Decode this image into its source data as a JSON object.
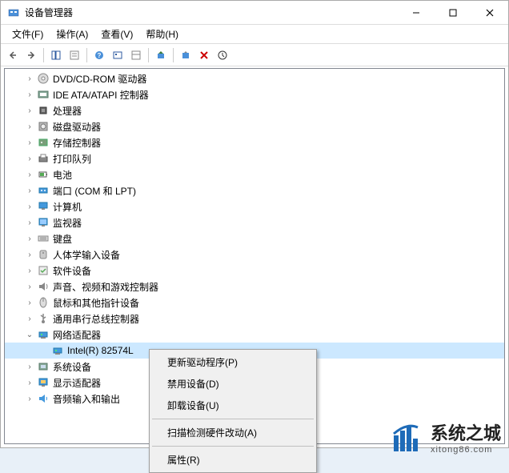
{
  "window": {
    "title": "设备管理器"
  },
  "menubar": {
    "file": "文件(F)",
    "action": "操作(A)",
    "view": "查看(V)",
    "help": "帮助(H)"
  },
  "tree": {
    "items": [
      {
        "expander": ">",
        "icon": "dvd",
        "label": "DVD/CD-ROM 驱动器"
      },
      {
        "expander": ">",
        "icon": "ide",
        "label": "IDE ATA/ATAPI 控制器"
      },
      {
        "expander": ">",
        "icon": "cpu",
        "label": "处理器"
      },
      {
        "expander": ">",
        "icon": "disk",
        "label": "磁盘驱动器"
      },
      {
        "expander": ">",
        "icon": "storage",
        "label": "存储控制器"
      },
      {
        "expander": ">",
        "icon": "printer",
        "label": "打印队列"
      },
      {
        "expander": ">",
        "icon": "battery",
        "label": "电池"
      },
      {
        "expander": ">",
        "icon": "port",
        "label": "端口 (COM 和 LPT)"
      },
      {
        "expander": ">",
        "icon": "computer",
        "label": "计算机"
      },
      {
        "expander": ">",
        "icon": "monitor",
        "label": "监视器"
      },
      {
        "expander": ">",
        "icon": "keyboard",
        "label": "键盘"
      },
      {
        "expander": ">",
        "icon": "hid",
        "label": "人体学输入设备"
      },
      {
        "expander": ">",
        "icon": "software",
        "label": "软件设备"
      },
      {
        "expander": ">",
        "icon": "sound",
        "label": "声音、视频和游戏控制器"
      },
      {
        "expander": ">",
        "icon": "mouse",
        "label": "鼠标和其他指针设备"
      },
      {
        "expander": ">",
        "icon": "usb",
        "label": "通用串行总线控制器"
      },
      {
        "expander": "v",
        "icon": "network",
        "label": "网络适配器",
        "expanded": true
      },
      {
        "expander": ">",
        "icon": "system",
        "label": "系统设备"
      },
      {
        "expander": ">",
        "icon": "display",
        "label": "显示适配器"
      },
      {
        "expander": ">",
        "icon": "audio",
        "label": "音频输入和输出"
      }
    ],
    "selected_child": "Intel(R) 82574L"
  },
  "context_menu": {
    "update_driver": "更新驱动程序(P)",
    "disable_device": "禁用设备(D)",
    "uninstall_device": "卸载设备(U)",
    "scan_hardware": "扫描检测硬件改动(A)",
    "properties": "属性(R)"
  },
  "watermark": {
    "main": "系统之城",
    "sub": "xitong86.com"
  }
}
